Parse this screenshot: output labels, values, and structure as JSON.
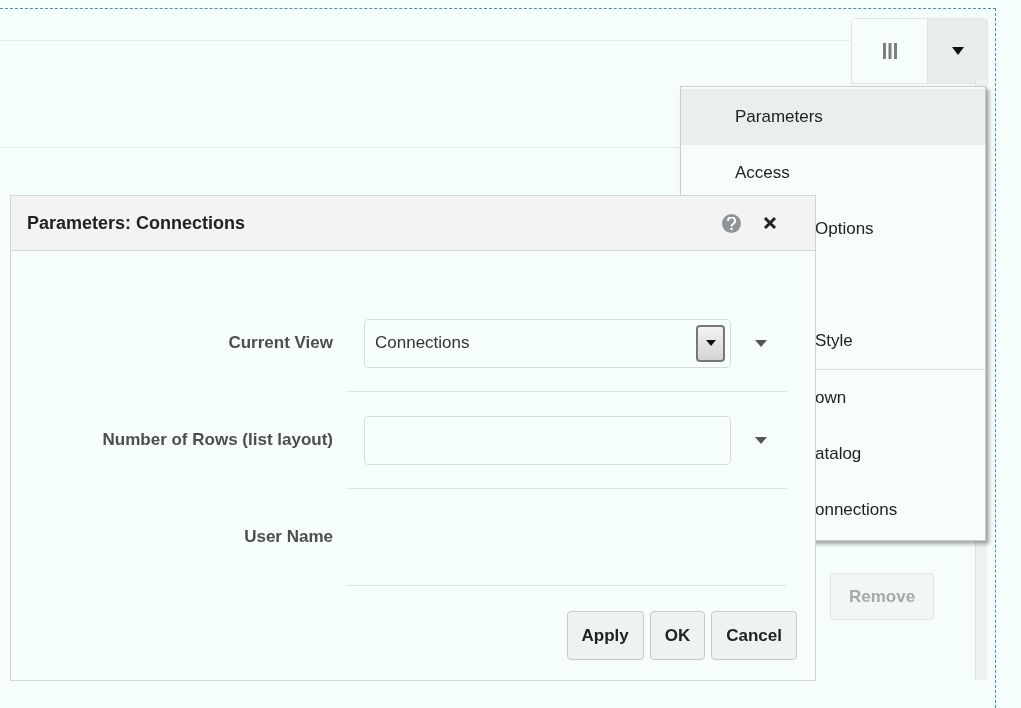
{
  "toolbar": {
    "buttons": [
      {
        "kind": "columns"
      },
      {
        "kind": "caret"
      }
    ]
  },
  "menu": {
    "items": [
      {
        "label": "Parameters",
        "selected": true,
        "kind": "full"
      },
      {
        "label": "Access",
        "selected": false,
        "kind": "full"
      },
      {
        "label": "Options",
        "selected": false,
        "kind": "clipped"
      },
      {
        "selected": false,
        "kind": "hidden"
      },
      {
        "label": "Style",
        "selected": false,
        "kind": "clipped"
      },
      {
        "kind": "separator"
      },
      {
        "label": "own",
        "selected": false,
        "kind": "clipped"
      },
      {
        "label": "atalog",
        "selected": false,
        "kind": "clipped"
      },
      {
        "label": "onnections",
        "selected": false,
        "kind": "clipped"
      }
    ]
  },
  "background_buttons": [
    {
      "label": "Remove",
      "disabled": true
    }
  ],
  "dialog": {
    "title": "Parameters: Connections",
    "fields": [
      {
        "label": "Current View",
        "kind": "select",
        "value": "Connections"
      },
      {
        "label": "Number of Rows (list layout)",
        "kind": "combo"
      },
      {
        "label": "User Name",
        "kind": "text"
      }
    ],
    "buttons": [
      "Apply",
      "OK",
      "Cancel"
    ]
  }
}
